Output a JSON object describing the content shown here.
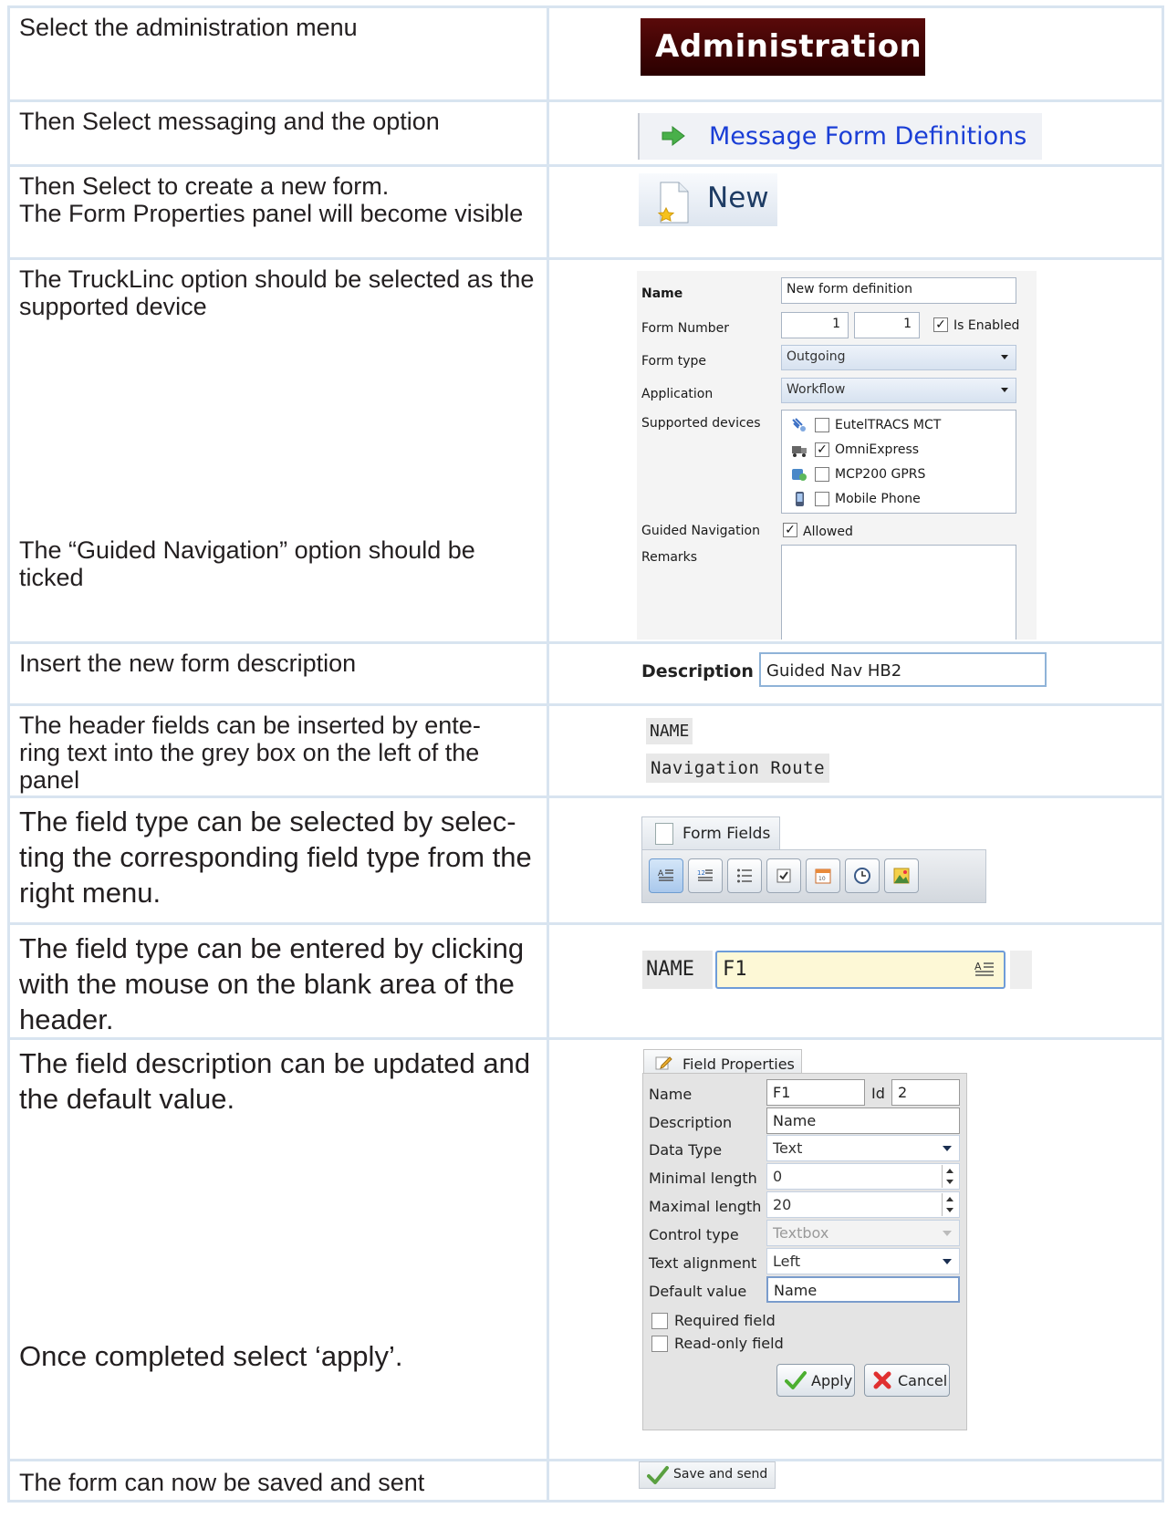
{
  "steps": [
    {
      "instruction": "Select the administration menu"
    },
    {
      "instruction": "Then Select messaging and the option"
    },
    {
      "instruction": "Then Select to create a new form.\nThe Form Properties panel will become visible"
    },
    {
      "instruction": "The TruckLinc option should be selected as the supported device",
      "instruction2": "The “Guided Navigation” option should be ticked"
    },
    {
      "instruction": "Insert the new form description"
    },
    {
      "instruction": "The header fields can be inserted by ente-\nring text into the grey box on the left of the panel"
    },
    {
      "instruction": "The field type can be selected by selec-\nting the corresponding field type from the right menu."
    },
    {
      "instruction": "The field type can be entered by clicking with the mouse on the blank area of the header."
    },
    {
      "instruction": "The field description can be updated and the default value.",
      "instruction2": "Once completed select ‘apply’."
    },
    {
      "instruction": "The form can now be saved and sent"
    }
  ],
  "admin_banner": {
    "label": "Administration",
    "color": "#3a0505"
  },
  "message_menu": {
    "label": "Message Form Definitions",
    "icon": "green-arrow-icon",
    "color": "#1a3ed6"
  },
  "new_button": {
    "label": "New",
    "icon": "new-document-icon"
  },
  "form_properties": {
    "name_label": "Name",
    "name_value": "New form definition",
    "form_number_label": "Form Number",
    "form_number_1": "1",
    "form_number_2": "1",
    "is_enabled_label": "Is Enabled",
    "is_enabled": true,
    "form_type_label": "Form type",
    "form_type_value": "Outgoing",
    "application_label": "Application",
    "application_value": "Workflow",
    "supported_devices_label": "Supported devices",
    "devices": [
      {
        "name": "EutelTRACS MCT",
        "checked": false,
        "icon": "satellite-icon"
      },
      {
        "name": "OmniExpress",
        "checked": true,
        "icon": "truck-icon"
      },
      {
        "name": "MCP200 GPRS",
        "checked": false,
        "icon": "gprs-device-icon"
      },
      {
        "name": "Mobile Phone",
        "checked": false,
        "icon": "mobile-phone-icon"
      }
    ],
    "guided_navigation_label": "Guided Navigation",
    "guided_navigation_value": "Allowed",
    "guided_navigation_checked": true,
    "remarks_label": "Remarks"
  },
  "description": {
    "label": "Description",
    "value": "Guided Nav HB2"
  },
  "header_fields": {
    "field1": "NAME",
    "field2": "Navigation Route"
  },
  "form_fields": {
    "tab_label": "Form Fields",
    "tools": [
      "text-field-icon",
      "numeric-field-icon",
      "list-field-icon",
      "checkbox-field-icon",
      "date-field-icon",
      "time-field-icon",
      "image-field-icon"
    ]
  },
  "name_field": {
    "label": "NAME",
    "value": "F1"
  },
  "field_properties": {
    "tab_label": "Field Properties",
    "name_label": "Name",
    "name_value": "F1",
    "id_label": "Id",
    "id_value": "2",
    "description_label": "Description",
    "description_value": "Name",
    "data_type_label": "Data Type",
    "data_type_value": "Text",
    "min_length_label": "Minimal length",
    "min_length_value": "0",
    "max_length_label": "Maximal length",
    "max_length_value": "20",
    "control_type_label": "Control type",
    "control_type_value": "Textbox",
    "text_alignment_label": "Text alignment",
    "text_alignment_value": "Left",
    "default_value_label": "Default value",
    "default_value_value": "Name",
    "required_label": "Required field",
    "readonly_label": "Read-only field",
    "apply_label": "Apply",
    "cancel_label": "Cancel"
  },
  "save_send": {
    "label": "Save and send"
  }
}
